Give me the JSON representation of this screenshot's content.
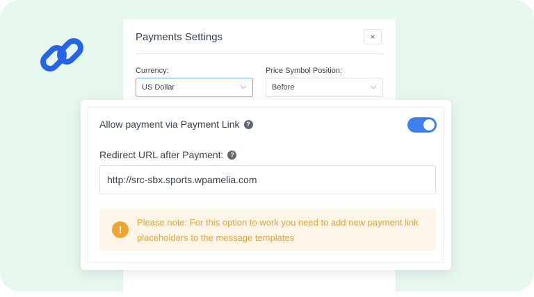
{
  "dialog": {
    "title": "Payments Settings",
    "close_label": "×",
    "currency_label": "Currency:",
    "currency_value": "US Dollar",
    "symbol_position_label": "Price Symbol Position:",
    "symbol_position_value": "Before"
  },
  "panel": {
    "allow_label": "Allow payment via Payment Link",
    "allow_enabled": true,
    "redirect_label": "Redirect URL after Payment:",
    "redirect_value": "http://src-sbx.sports.wpamelia.com",
    "help_glyph": "?",
    "note_icon_glyph": "!",
    "note_text": "Please note: For this option to work you need to add new payment link placeholders to the message templates"
  },
  "colors": {
    "background": "#e6f7ee",
    "accent": "#3d7ef0",
    "link_icon": "#2563eb",
    "warning": "#f1a531",
    "warning_text": "#e6a23c",
    "note_background": "#fdf5e8"
  },
  "icons": [
    "link-icon",
    "close-icon",
    "chevron-down-icon",
    "help-icon",
    "warning-icon"
  ]
}
